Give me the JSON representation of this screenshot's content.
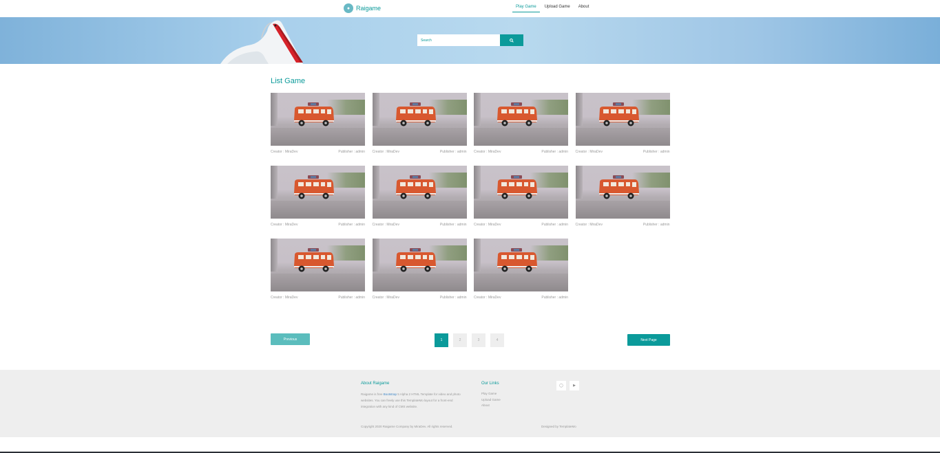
{
  "header": {
    "brand": "Raigame",
    "nav": [
      {
        "label": "Play Game",
        "active": true
      },
      {
        "label": "Upload Game",
        "active": false
      },
      {
        "label": "About",
        "active": false
      }
    ]
  },
  "hero": {
    "search_placeholder": "Search"
  },
  "list": {
    "title": "List Game",
    "cards": [
      {
        "creator": "Creator : MiraDev",
        "publisher": "Publisher : admin"
      },
      {
        "creator": "Creator : MiraDev",
        "publisher": "Publisher : admin"
      },
      {
        "creator": "Creator : MiraDev",
        "publisher": "Publisher : admin"
      },
      {
        "creator": "Creator : MiraDev",
        "publisher": "Publisher : admin"
      },
      {
        "creator": "Creator : MiraDev",
        "publisher": "Publisher : admin"
      },
      {
        "creator": "Creator : MiraDev",
        "publisher": "Publisher : admin"
      },
      {
        "creator": "Creator : MiraDev",
        "publisher": "Publisher : admin"
      },
      {
        "creator": "Creator : MiraDev",
        "publisher": "Publisher : admin"
      },
      {
        "creator": "Creator : MiraDev",
        "publisher": "Publisher : admin"
      },
      {
        "creator": "Creator : MiraDev",
        "publisher": "Publisher : admin"
      },
      {
        "creator": "Creator : MiraDev",
        "publisher": "Publisher : admin"
      }
    ]
  },
  "pagination": {
    "previous": "Previous",
    "next": "Next Page",
    "pages": [
      "1",
      "2",
      "3",
      "4"
    ],
    "current": "1"
  },
  "footer": {
    "about_title": "About Raigame",
    "about_text_before": "Raigame is free ",
    "about_link": "Bootstrap",
    "about_text_after": " 5 Alpha 2 HTML Template for video and photo websites. You can freely use this TemplateMo layout for a front-end integration with any kind of CMS website.",
    "links_title": "Our Links",
    "links": [
      "Play Game",
      "Upload Game",
      "About"
    ],
    "copyright": "Copyright 2020 Raigame Company by MiraDev. All rights reserved.",
    "designed": "Designed by TemplateMo"
  },
  "colors": {
    "accent": "#0b9a9a",
    "footer_bg": "#eeeeee"
  }
}
